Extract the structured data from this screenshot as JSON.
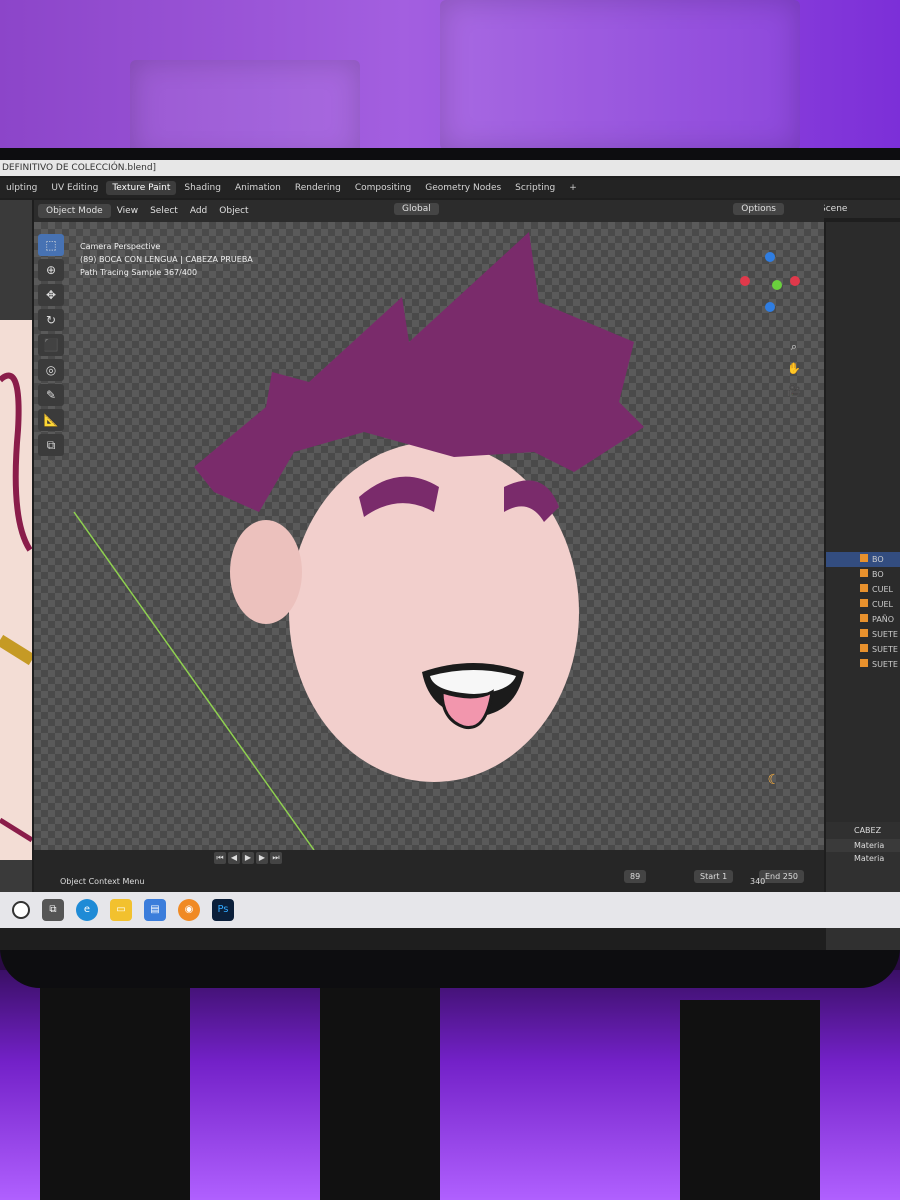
{
  "app": {
    "title": "DEFINITIVO DE COLECCIÓN.blend]",
    "workspaces": [
      "ulpting",
      "UV Editing",
      "Texture Paint",
      "Shading",
      "Animation",
      "Rendering",
      "Compositing",
      "Geometry Nodes",
      "Scripting",
      "+"
    ],
    "active_workspace": "Texture Paint",
    "scene_label": "Scene"
  },
  "viewport_header": {
    "mode": "Object Mode",
    "menus": [
      "View",
      "Select",
      "Add",
      "Object"
    ],
    "orientation": "Global",
    "options": "Options"
  },
  "viewport_info": {
    "line1": "Camera Perspective",
    "line2": "(89) BOCA CON LENGUA | CABEZA PRUEBA",
    "line3": "Path Tracing Sample 367/400"
  },
  "toolbar_tools": [
    {
      "icon": "select-icon",
      "glyph": "⬚",
      "active": true
    },
    {
      "icon": "cursor-icon",
      "glyph": "⊕",
      "active": false
    },
    {
      "icon": "move-icon",
      "glyph": "✥",
      "active": false
    },
    {
      "icon": "rotate-icon",
      "glyph": "↻",
      "active": false
    },
    {
      "icon": "scale-icon",
      "glyph": "⬛",
      "active": false
    },
    {
      "icon": "transform-icon",
      "glyph": "◎",
      "active": false
    },
    {
      "icon": "annotate-icon",
      "glyph": "✎",
      "active": false
    },
    {
      "icon": "measure-icon",
      "glyph": "📐",
      "active": false
    },
    {
      "icon": "add-cube-icon",
      "glyph": "⧉",
      "active": false
    }
  ],
  "outliner": {
    "rows": [
      "BO",
      "BO",
      "CUEL",
      "CUEL",
      "PAÑO",
      "SUETE",
      "SUETE",
      "SUETE"
    ]
  },
  "properties": {
    "object_name": "CABEZ",
    "materials": [
      "Materia",
      "Materia"
    ]
  },
  "timeline": {
    "current_frame": "89",
    "start_label": "Start",
    "start_value": "1",
    "end_label": "End",
    "end_value": "250",
    "frame_marker": "340"
  },
  "statusbar": {
    "text": "Object Context Menu"
  },
  "taskbar": {
    "icons": [
      "windows-start-icon",
      "task-view-icon",
      "edge-icon",
      "file-explorer-icon",
      "store-icon",
      "blender-icon",
      "photoshop-icon"
    ],
    "photoshop_label": "Ps"
  },
  "colors": {
    "hair": "#7a2b6b",
    "skin": "#f0c9c6",
    "accent_blue": "#4772b3",
    "room_purple": "#8c45c9"
  }
}
